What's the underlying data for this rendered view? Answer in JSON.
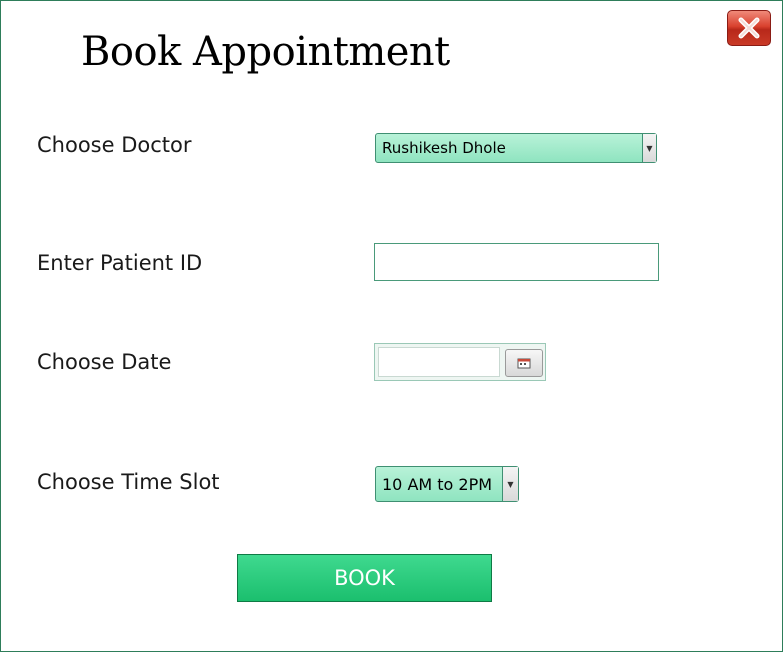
{
  "window": {
    "title": "Book Appointment"
  },
  "icons": {
    "close": "close-icon",
    "calendar": "calendar-icon",
    "dropdown": "chevron-down-icon"
  },
  "form": {
    "doctor": {
      "label": "Choose Doctor",
      "selected": "Rushikesh Dhole"
    },
    "patient_id": {
      "label": "Enter Patient ID",
      "value": ""
    },
    "date": {
      "label": "Choose Date",
      "value": ""
    },
    "time_slot": {
      "label": "Choose Time Slot",
      "selected": "10 AM to 2PM"
    }
  },
  "actions": {
    "book_label": "BOOK"
  },
  "colors": {
    "combo_fill": "#8fe4c0",
    "book_button": "#1bbf6e",
    "close_button": "#d9412e",
    "window_border": "#2e7d5a"
  }
}
